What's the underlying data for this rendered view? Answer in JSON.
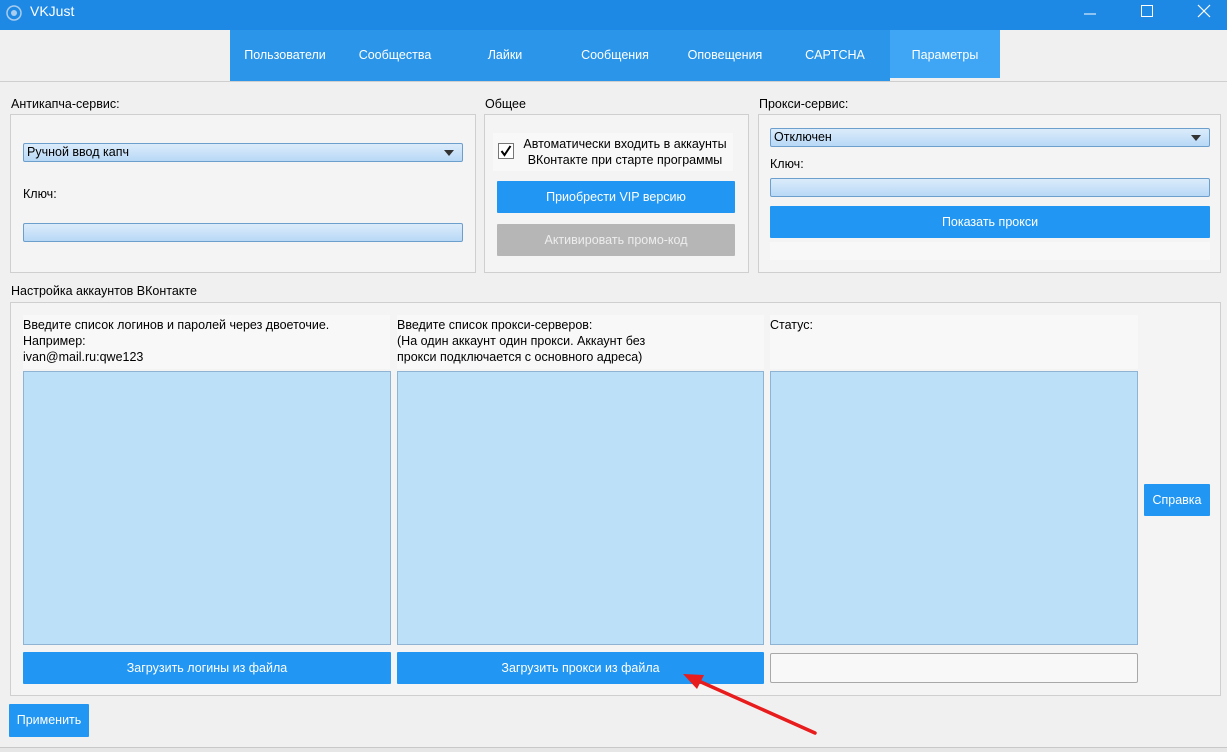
{
  "window": {
    "title": "VKJust"
  },
  "tabs": [
    {
      "label": "Пользователи"
    },
    {
      "label": "Сообщества"
    },
    {
      "label": "Лайки"
    },
    {
      "label": "Сообщения"
    },
    {
      "label": "Оповещения"
    },
    {
      "label": "CAPTCHA"
    },
    {
      "label": "Параметры",
      "active": true
    }
  ],
  "anticaptcha": {
    "group_label": "Антикапча-сервис:",
    "selected": "Ручной ввод капч",
    "key_label": "Ключ:",
    "key_value": ""
  },
  "general": {
    "group_label": "Общее",
    "autologin_checked": true,
    "autologin_label": "Автоматически входить в аккаунты\nВКонтакте при старте программы",
    "vip_button": "Приобрести VIP версию",
    "promo_button": "Активировать промо-код"
  },
  "proxy": {
    "group_label": "Прокси-сервис:",
    "selected": "Отключен",
    "key_label": "Ключ:",
    "key_value": "",
    "show_button": "Показать прокси"
  },
  "accounts": {
    "group_label": "Настройка аккаунтов ВКонтакте",
    "logins_desc": "Введите список логинов и паролей через двоеточие.\nНапример:\nivan@mail.ru:qwe123",
    "proxies_desc": "Введите список прокси-серверов:\n(На один аккаунт один прокси. Аккаунт без\nпрокси подключается с основного адреса)",
    "status_label": "Статус:",
    "load_logins_button": "Загрузить логины из файла",
    "load_proxies_button": "Загрузить прокси из файла",
    "help_button": "Справка"
  },
  "footer": {
    "apply_button": "Применить"
  },
  "colors": {
    "accent": "#2196f3",
    "titlebar": "#1e88e5",
    "list_bg": "#bde0f9",
    "annotation_arrow": "#e81c1c"
  }
}
